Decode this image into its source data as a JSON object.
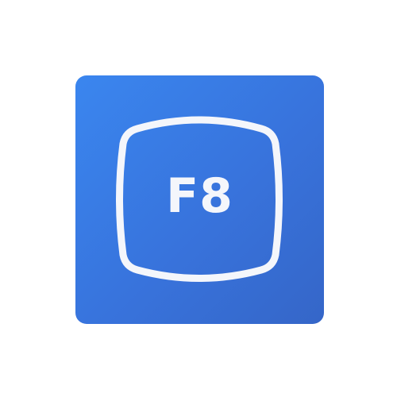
{
  "icon": {
    "key_label": "F8",
    "background_colors": [
      "#3a86ef",
      "#3873dc",
      "#3566c8"
    ],
    "foreground_color": "#f4f6fb",
    "shape": "function-key-icon"
  }
}
